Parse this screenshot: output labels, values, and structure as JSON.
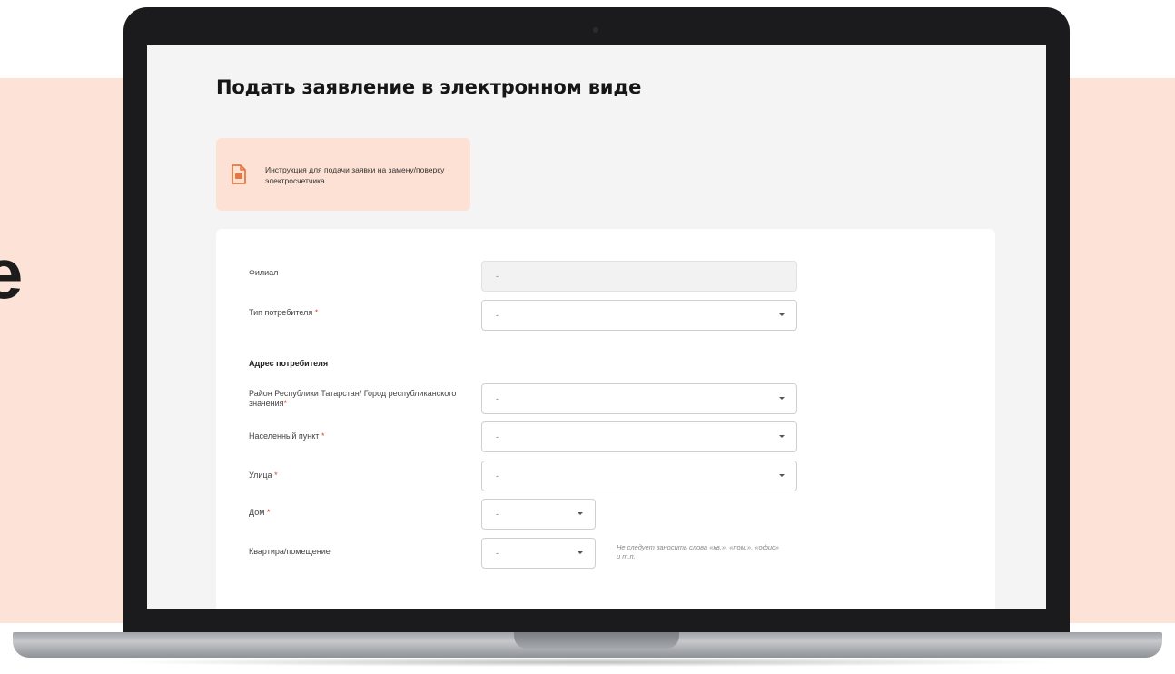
{
  "side_fragment": "e",
  "page": {
    "title": "Подать заявление в электронном виде"
  },
  "instruction": {
    "icon": "document-icon",
    "text": "Инструкция для подачи заявки на замену/поверку электросчетчика"
  },
  "form": {
    "branch": {
      "label": "Филиал",
      "value": "-"
    },
    "consumer_type": {
      "label": "Тип потребителя",
      "required_mark": "*",
      "value": "-"
    },
    "address_section_title": "Адрес потребителя",
    "district": {
      "label": "Район Республики Татарстан/ Город республиканского значения",
      "required_mark": "*",
      "value": "-"
    },
    "settlement": {
      "label": "Населенный пункт",
      "required_mark": "*",
      "value": "-"
    },
    "street": {
      "label": "Улица",
      "required_mark": "*",
      "value": "-"
    },
    "house": {
      "label": "Дом",
      "required_mark": "*",
      "value": "-"
    },
    "apartment": {
      "label": "Квартира/помещение",
      "value": "-"
    },
    "apartment_hint": "Не следует заносить слова «кв.», «пом.», «офис» и т.п."
  },
  "colors": {
    "accent": "#e8773f",
    "peach_background": "#fde3d7",
    "required": "#e0442a"
  }
}
